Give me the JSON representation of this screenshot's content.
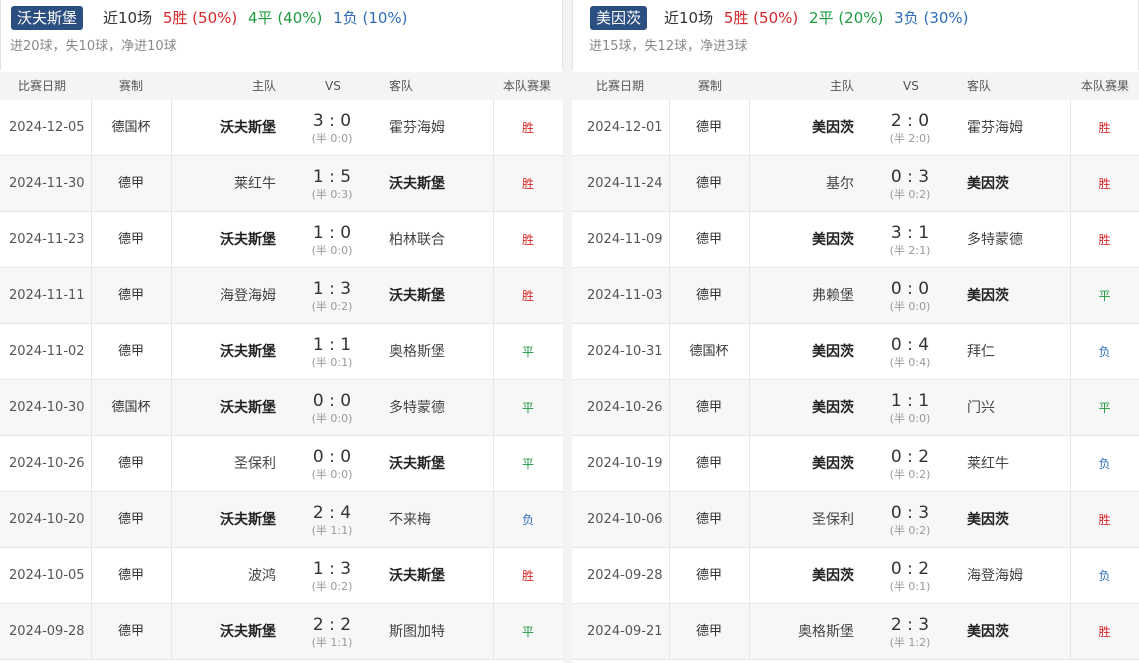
{
  "table_headers": {
    "date": "比赛日期",
    "competition": "赛制",
    "home": "主队",
    "vs": "VS",
    "away": "客队",
    "result": "本队赛果"
  },
  "left": {
    "team": "沃夫斯堡",
    "recent_label": "近10场",
    "wins": "5胜 (50%)",
    "draws": "4平 (40%)",
    "losses": "1负 (10%)",
    "goals": "进20球，失10球，净进10球",
    "matches": [
      {
        "date": "2024-12-05",
        "comp": "德国杯",
        "home": "沃夫斯堡",
        "score": "3 : 0",
        "half": "(半 0:0)",
        "away": "霍芬海姆",
        "result": "胜",
        "home_is_team": true
      },
      {
        "date": "2024-11-30",
        "comp": "德甲",
        "home": "莱红牛",
        "score": "1 : 5",
        "half": "(半 0:3)",
        "away": "沃夫斯堡",
        "result": "胜",
        "home_is_team": false
      },
      {
        "date": "2024-11-23",
        "comp": "德甲",
        "home": "沃夫斯堡",
        "score": "1 : 0",
        "half": "(半 0:0)",
        "away": "柏林联合",
        "result": "胜",
        "home_is_team": true
      },
      {
        "date": "2024-11-11",
        "comp": "德甲",
        "home": "海登海姆",
        "score": "1 : 3",
        "half": "(半 0:2)",
        "away": "沃夫斯堡",
        "result": "胜",
        "home_is_team": false
      },
      {
        "date": "2024-11-02",
        "comp": "德甲",
        "home": "沃夫斯堡",
        "score": "1 : 1",
        "half": "(半 0:1)",
        "away": "奥格斯堡",
        "result": "平",
        "home_is_team": true
      },
      {
        "date": "2024-10-30",
        "comp": "德国杯",
        "home": "沃夫斯堡",
        "score": "0 : 0",
        "half": "(半 0:0)",
        "away": "多特蒙德",
        "result": "平",
        "home_is_team": true
      },
      {
        "date": "2024-10-26",
        "comp": "德甲",
        "home": "圣保利",
        "score": "0 : 0",
        "half": "(半 0:0)",
        "away": "沃夫斯堡",
        "result": "平",
        "home_is_team": false
      },
      {
        "date": "2024-10-20",
        "comp": "德甲",
        "home": "沃夫斯堡",
        "score": "2 : 4",
        "half": "(半 1:1)",
        "away": "不来梅",
        "result": "负",
        "home_is_team": true
      },
      {
        "date": "2024-10-05",
        "comp": "德甲",
        "home": "波鸿",
        "score": "1 : 3",
        "half": "(半 0:2)",
        "away": "沃夫斯堡",
        "result": "胜",
        "home_is_team": false
      },
      {
        "date": "2024-09-28",
        "comp": "德甲",
        "home": "沃夫斯堡",
        "score": "2 : 2",
        "half": "(半 1:1)",
        "away": "斯图加特",
        "result": "平",
        "home_is_team": true
      }
    ]
  },
  "right": {
    "team": "美因茨",
    "recent_label": "近10场",
    "wins": "5胜 (50%)",
    "draws": "2平 (20%)",
    "losses": "3负 (30%)",
    "goals": "进15球，失12球，净进3球",
    "matches": [
      {
        "date": "2024-12-01",
        "comp": "德甲",
        "home": "美因茨",
        "score": "2 : 0",
        "half": "(半 2:0)",
        "away": "霍芬海姆",
        "result": "胜",
        "home_is_team": true
      },
      {
        "date": "2024-11-24",
        "comp": "德甲",
        "home": "基尔",
        "score": "0 : 3",
        "half": "(半 0:2)",
        "away": "美因茨",
        "result": "胜",
        "home_is_team": false
      },
      {
        "date": "2024-11-09",
        "comp": "德甲",
        "home": "美因茨",
        "score": "3 : 1",
        "half": "(半 2:1)",
        "away": "多特蒙德",
        "result": "胜",
        "home_is_team": true
      },
      {
        "date": "2024-11-03",
        "comp": "德甲",
        "home": "弗赖堡",
        "score": "0 : 0",
        "half": "(半 0:0)",
        "away": "美因茨",
        "result": "平",
        "home_is_team": false
      },
      {
        "date": "2024-10-31",
        "comp": "德国杯",
        "home": "美因茨",
        "score": "0 : 4",
        "half": "(半 0:4)",
        "away": "拜仁",
        "result": "负",
        "home_is_team": true
      },
      {
        "date": "2024-10-26",
        "comp": "德甲",
        "home": "美因茨",
        "score": "1 : 1",
        "half": "(半 0:0)",
        "away": "门兴",
        "result": "平",
        "home_is_team": true
      },
      {
        "date": "2024-10-19",
        "comp": "德甲",
        "home": "美因茨",
        "score": "0 : 2",
        "half": "(半 0:2)",
        "away": "莱红牛",
        "result": "负",
        "home_is_team": true
      },
      {
        "date": "2024-10-06",
        "comp": "德甲",
        "home": "圣保利",
        "score": "0 : 3",
        "half": "(半 0:2)",
        "away": "美因茨",
        "result": "胜",
        "home_is_team": false
      },
      {
        "date": "2024-09-28",
        "comp": "德甲",
        "home": "美因茨",
        "score": "0 : 2",
        "half": "(半 0:1)",
        "away": "海登海姆",
        "result": "负",
        "home_is_team": true
      },
      {
        "date": "2024-09-21",
        "comp": "德甲",
        "home": "奥格斯堡",
        "score": "2 : 3",
        "half": "(半 1:2)",
        "away": "美因茨",
        "result": "胜",
        "home_is_team": false
      }
    ]
  },
  "colors": {
    "badge_bg": "#2c4f82",
    "win": "#d6282b",
    "draw": "#1e9a40",
    "loss": "#2d6db9"
  }
}
